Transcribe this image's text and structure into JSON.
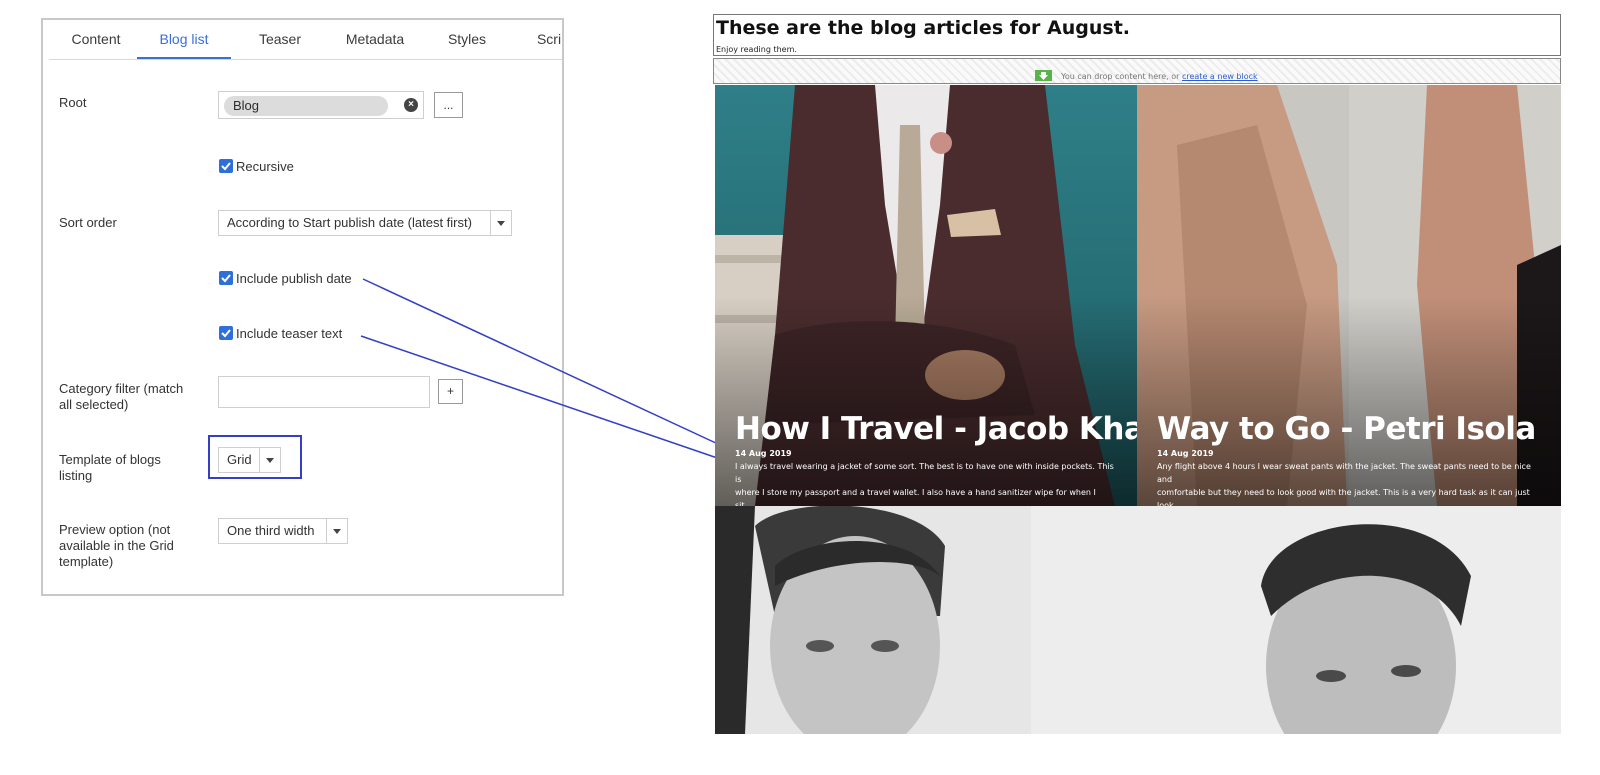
{
  "panel": {
    "tabs": [
      {
        "label": "Content"
      },
      {
        "label": "Blog list"
      },
      {
        "label": "Teaser"
      },
      {
        "label": "Metadata"
      },
      {
        "label": "Styles"
      },
      {
        "label": "Scri"
      }
    ],
    "active_tab": "Blog list",
    "root": {
      "label": "Root",
      "value": "Blog",
      "browse_label": "..."
    },
    "recursive": {
      "label": "Recursive",
      "checked": true
    },
    "sort_order": {
      "label": "Sort order",
      "value": "According to Start publish date (latest first)"
    },
    "include_publish_date": {
      "label": "Include publish date",
      "checked": true
    },
    "include_teaser_text": {
      "label": "Include teaser text",
      "checked": true
    },
    "category_filter": {
      "label_line1": "Category filter (match",
      "label_line2": "all selected)",
      "value": "",
      "add_label": "+"
    },
    "template": {
      "label_line1": "Template of blogs",
      "label_line2": "listing",
      "value": "Grid"
    },
    "preview_option": {
      "label_line1": "Preview option (not",
      "label_line2": "available in the Grid",
      "label_line3": "template)",
      "value": "One third width"
    }
  },
  "preview": {
    "heading": "These are the blog articles for August.",
    "subheading": "Enjoy reading them.",
    "dropzone_text": "You can drop content here, or",
    "dropzone_link": "create a new block",
    "cards": [
      {
        "title": "How I Travel - Jacob Khan",
        "date": "14 Aug 2019",
        "text_line1": "I always travel wearing a jacket of some sort. The best is to have one with inside pockets. This is",
        "text_line2": "where I store my passport and a travel wallet. I also have a hand sanitizer wipe for when I sit..."
      },
      {
        "title": "Way to Go - Petri Isola",
        "date": "14 Aug 2019",
        "text_line1": "Any flight above 4 hours I wear sweat pants with the jacket. The sweat pants need to be nice and",
        "text_line2": "comfortable but they need to look good with the jacket. This is a very hard task as it can just look..."
      }
    ]
  },
  "colors": {
    "accent": "#3a6fd8",
    "annotation": "#3340c6",
    "checkbox": "#2f6fd9"
  }
}
